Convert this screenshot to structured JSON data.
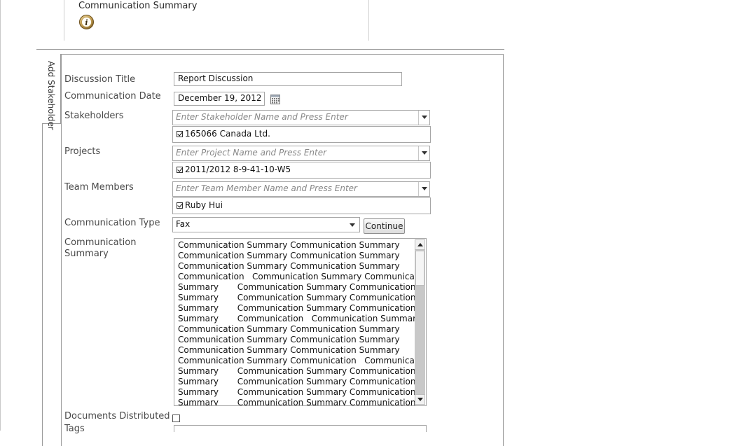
{
  "header": {
    "title": "Communication Summary",
    "info_icon": "info-icon"
  },
  "side_tab": {
    "label": "Add Stakeholder"
  },
  "form": {
    "discussion_title": {
      "label": "Discussion Title",
      "value": "Report Discussion"
    },
    "communication_date": {
      "label": "Communication Date",
      "value": "December 19, 2012",
      "icon": "calendar-icon"
    },
    "stakeholders": {
      "label": "Stakeholders",
      "placeholder": "Enter Stakeholder Name and Press Enter",
      "selected": "165066 Canada Ltd."
    },
    "projects": {
      "label": "Projects",
      "placeholder": "Enter Project Name  and Press Enter",
      "selected": "2011/2012 8-9-41-10-W5"
    },
    "team_members": {
      "label": "Team Members",
      "placeholder": "Enter Team Member Name  and Press Enter",
      "selected": "Ruby Hui"
    },
    "communication_type": {
      "label": "Communication Type",
      "value": "Fax",
      "continue_label": "Continue"
    },
    "communication_summary": {
      "label_line1": "Communication",
      "label_line2": "Summary",
      "lines": [
        "Communication Summary Communication Summary",
        "Communication Summary Communication Summary",
        "Communication Summary Communication Summary",
        "Communication   Communication Summary Communication",
        "Summary       Communication Summary Communication",
        "Summary       Communication Summary Communication",
        "Summary       Communication Summary Communication",
        "Summary       Communication   Communication Summary",
        "Communication Summary Communication Summary",
        "Communication Summary Communication Summary",
        "Communication Summary Communication Summary",
        "Communication Summary Communication   Communication",
        "Summary       Communication Summary Communication",
        "Summary       Communication Summary Communication",
        "Summary       Communication Summary Communication",
        "Summary       Communication Summary Communication"
      ]
    },
    "documents_distributed": {
      "label": "Documents Distributed",
      "checked": false
    },
    "tags": {
      "label": "Tags"
    }
  },
  "colors": {
    "border": "#a6a6a6",
    "label": "#4a4a4a",
    "scrollbar": "#c8c8c8"
  }
}
